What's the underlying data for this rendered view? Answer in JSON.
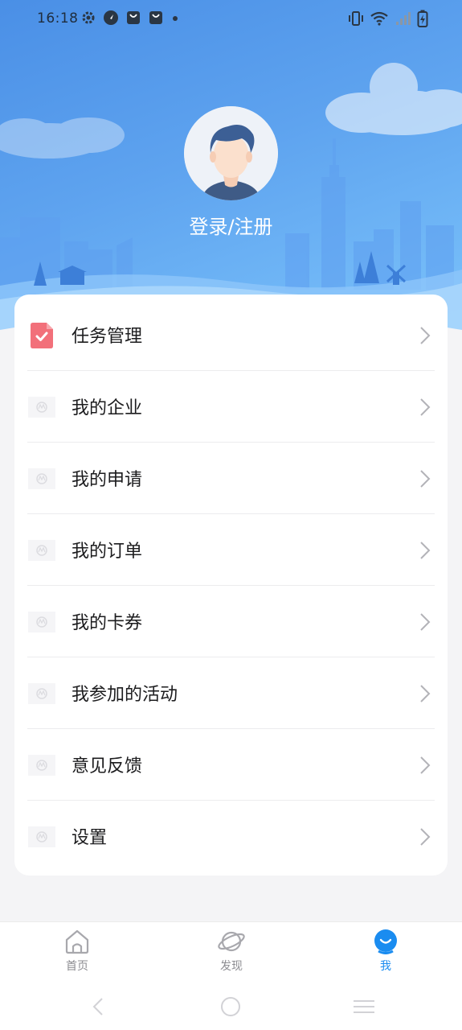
{
  "status_bar": {
    "time": "16:18",
    "left_icons": [
      "settings-gear-icon",
      "compass-icon",
      "shopping-bag-icon",
      "shopping-bag-icon",
      "dot-icon"
    ],
    "right_icons": [
      "vibrate-icon",
      "wifi-icon",
      "cellular-signal-icon",
      "battery-charging-icon"
    ]
  },
  "header": {
    "login_label": "登录/注册"
  },
  "menu": {
    "items": [
      {
        "label": "任务管理",
        "icon": "task-document-icon"
      },
      {
        "label": "我的企业",
        "icon": "placeholder-logo-icon"
      },
      {
        "label": "我的申请",
        "icon": "placeholder-logo-icon"
      },
      {
        "label": "我的订单",
        "icon": "placeholder-logo-icon"
      },
      {
        "label": "我的卡券",
        "icon": "placeholder-logo-icon"
      },
      {
        "label": "我参加的活动",
        "icon": "placeholder-logo-icon"
      },
      {
        "label": "意见反馈",
        "icon": "placeholder-logo-icon"
      },
      {
        "label": "设置",
        "icon": "placeholder-logo-icon"
      }
    ]
  },
  "tab_bar": {
    "tabs": [
      {
        "label": "首页",
        "icon": "home-icon",
        "active": false
      },
      {
        "label": "发现",
        "icon": "planet-icon",
        "active": false
      },
      {
        "label": "我",
        "icon": "profile-smile-icon",
        "active": true
      }
    ]
  },
  "colors": {
    "accent": "#1a8cf0",
    "hero_top": "#4a8fe6",
    "hero_bottom": "#7cc4fb",
    "task_icon": "#f2707a"
  }
}
